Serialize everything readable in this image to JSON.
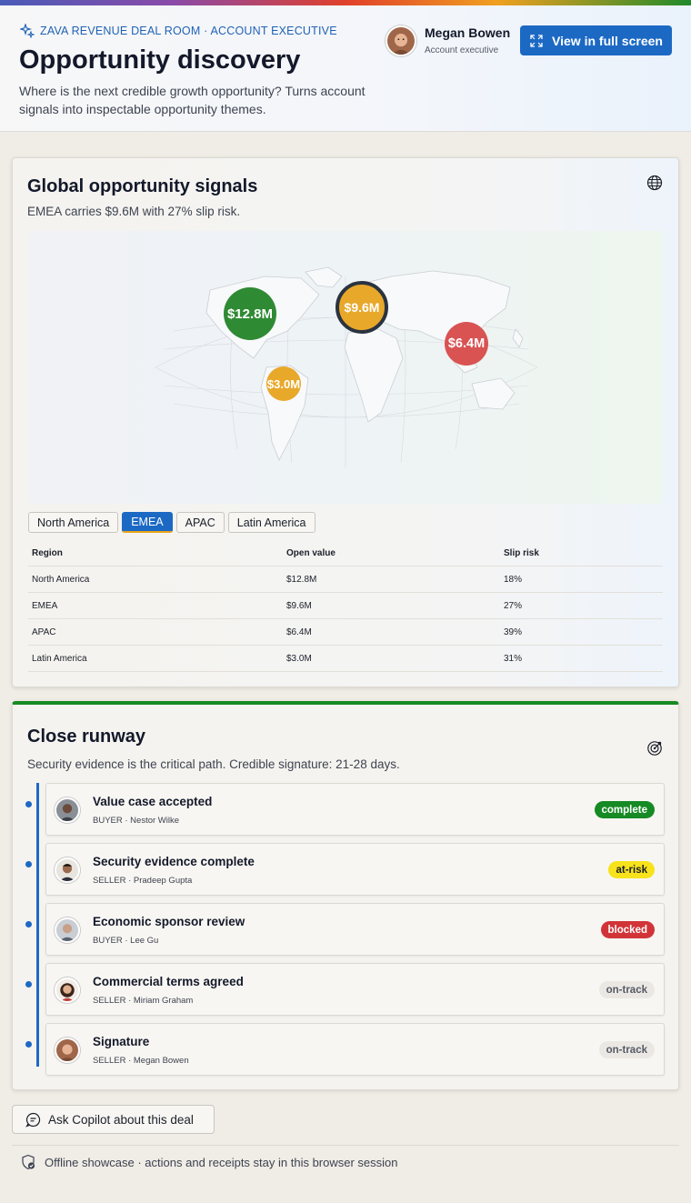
{
  "header": {
    "eyebrow": "ZAVA REVENUE DEAL ROOM · ACCOUNT EXECUTIVE",
    "title": "Opportunity discovery",
    "subtitle": "Where is the next credible growth opportunity? Turns account signals into inspectable opportunity themes.",
    "user_name": "Megan Bowen",
    "user_role": "Account executive",
    "fullscreen_label": "View in full screen"
  },
  "signals": {
    "title": "Global opportunity signals",
    "description": "EMEA carries $9.6M with 27% slip risk.",
    "selected_region": "EMEA",
    "bubbles": [
      {
        "region": "North America",
        "label": "$12.8M",
        "value": 12.8,
        "color": "#2f8a34"
      },
      {
        "region": "EMEA",
        "label": "$9.6M",
        "value": 9.6,
        "color": "#e8a82a",
        "selected": true
      },
      {
        "region": "APAC",
        "label": "$6.4M",
        "value": 6.4,
        "color": "#d95353"
      },
      {
        "region": "Latin America",
        "label": "$3.0M",
        "value": 3.0,
        "color": "#e8a82a"
      }
    ],
    "tabs": [
      "North America",
      "EMEA",
      "APAC",
      "Latin America"
    ],
    "table": {
      "headers": [
        "Region",
        "Open value",
        "Slip risk"
      ],
      "rows": [
        [
          "North America",
          "$12.8M",
          "18%"
        ],
        [
          "EMEA",
          "$9.6M",
          "27%"
        ],
        [
          "APAC",
          "$6.4M",
          "39%"
        ],
        [
          "Latin America",
          "$3.0M",
          "31%"
        ]
      ]
    }
  },
  "runway": {
    "title": "Close runway",
    "description": "Security evidence is the critical path. Credible signature: 21-28 days.",
    "milestones": [
      {
        "title": "Value case accepted",
        "meta": "BUYER · Nestor Wilke",
        "status": "complete"
      },
      {
        "title": "Security evidence complete",
        "meta": "SELLER · Pradeep Gupta",
        "status": "at-risk"
      },
      {
        "title": "Economic sponsor review",
        "meta": "BUYER · Lee Gu",
        "status": "blocked"
      },
      {
        "title": "Commercial terms agreed",
        "meta": "SELLER · Miriam Graham",
        "status": "on-track"
      },
      {
        "title": "Signature",
        "meta": "SELLER · Megan Bowen",
        "status": "on-track"
      }
    ]
  },
  "status_colors": {
    "complete": {
      "bg": "#168a24",
      "fg": "#ffffff"
    },
    "at-risk": {
      "bg": "#f7e21b",
      "fg": "#1b1f29"
    },
    "blocked": {
      "bg": "#d13438",
      "fg": "#ffffff"
    },
    "on-track": {
      "bg": "#ebe8e3",
      "fg": "#555a66"
    }
  },
  "actions": {
    "copilot_label": "Ask Copilot about this deal"
  },
  "footer": {
    "text": "Offline showcase · actions and receipts stay in this browser session"
  },
  "icons": {
    "eyebrow": "sparkle-icon",
    "fullscreen": "expand-icon",
    "signals": "globe-icon",
    "runway": "target-icon",
    "copilot": "chat-icon",
    "footer": "shield-check-icon"
  },
  "colors": {
    "accent": "#1c69c4",
    "success": "#168a24"
  }
}
